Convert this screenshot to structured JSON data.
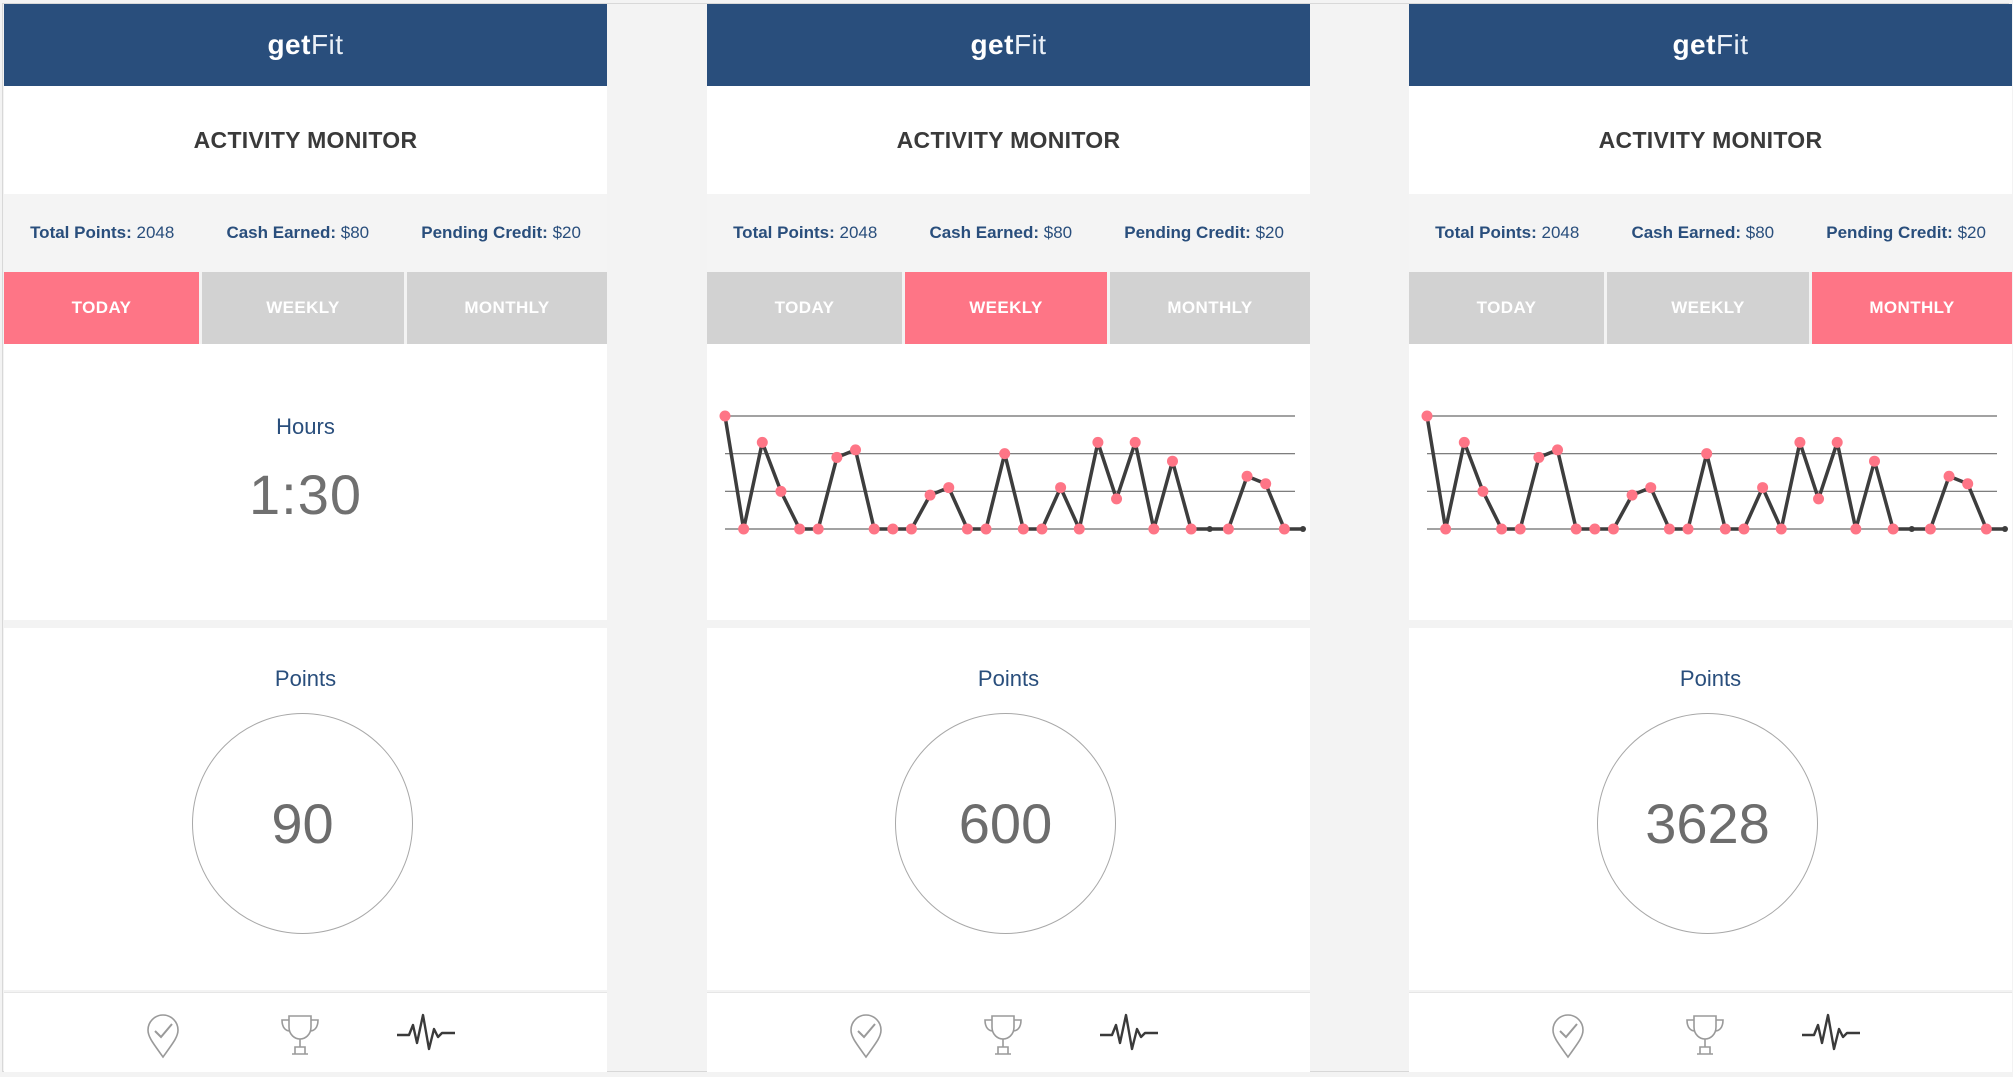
{
  "screens": [
    {
      "brand": {
        "bold": "get",
        "light": "Fit"
      },
      "title": "ACTIVITY MONITOR",
      "stats": [
        {
          "label": "Total Points:",
          "value": "2048"
        },
        {
          "label": "Cash Earned:",
          "value": "$80"
        },
        {
          "label": "Pending Credit:",
          "value": "$20"
        }
      ],
      "tabs": [
        {
          "label": "TODAY",
          "active": true
        },
        {
          "label": "WEEKLY",
          "active": false
        },
        {
          "label": "MONTHLY",
          "active": false
        }
      ],
      "hours": {
        "label": "Hours",
        "value": "1:30"
      },
      "points": {
        "label": "Points",
        "value": "90"
      },
      "nav": {
        "icons": [
          "check-pin-icon",
          "trophy-icon",
          "activity-pulse-icon"
        ]
      }
    },
    {
      "brand": {
        "bold": "get",
        "light": "Fit"
      },
      "title": "ACTIVITY MONITOR",
      "stats": [
        {
          "label": "Total Points:",
          "value": "2048"
        },
        {
          "label": "Cash Earned:",
          "value": "$80"
        },
        {
          "label": "Pending Credit:",
          "value": "$20"
        }
      ],
      "tabs": [
        {
          "label": "TODAY",
          "active": false
        },
        {
          "label": "WEEKLY",
          "active": true
        },
        {
          "label": "MONTHLY",
          "active": false
        }
      ],
      "points": {
        "label": "Points",
        "value": "600"
      },
      "nav": {
        "icons": [
          "check-pin-icon",
          "trophy-icon",
          "activity-pulse-icon"
        ]
      }
    },
    {
      "brand": {
        "bold": "get",
        "light": "Fit"
      },
      "title": "ACTIVITY MONITOR",
      "stats": [
        {
          "label": "Total Points:",
          "value": "2048"
        },
        {
          "label": "Cash Earned:",
          "value": "$80"
        },
        {
          "label": "Pending Credit:",
          "value": "$20"
        }
      ],
      "tabs": [
        {
          "label": "TODAY",
          "active": false
        },
        {
          "label": "WEEKLY",
          "active": false
        },
        {
          "label": "MONTHLY",
          "active": true
        }
      ],
      "points": {
        "label": "Points",
        "value": "3628"
      },
      "nav": {
        "icons": [
          "check-pin-icon",
          "trophy-icon",
          "activity-pulse-icon"
        ]
      }
    }
  ],
  "colors": {
    "header": "#294e7c",
    "accent": "#fe7586",
    "tab_inactive": "#d2d2d2",
    "line": "#3d3d3d",
    "gridline": "#6b6b6b"
  },
  "chart_data": [
    {
      "type": "line",
      "panel": "WEEKLY",
      "grid": true,
      "ylim": [
        0,
        3
      ],
      "x": [
        0,
        1,
        2,
        3,
        4,
        5,
        6,
        7,
        8,
        9,
        10,
        11,
        12,
        13,
        14,
        15,
        16,
        17,
        18,
        19,
        20,
        21,
        22,
        23,
        24,
        25,
        26,
        27,
        28,
        29,
        30,
        31
      ],
      "values": [
        3,
        0,
        2.3,
        1,
        0,
        0,
        1.9,
        2.1,
        0,
        0,
        0,
        0.9,
        1.1,
        0,
        0,
        2,
        0,
        0,
        1.1,
        0,
        2.3,
        0.8,
        2.3,
        0,
        1.8,
        0,
        0,
        0,
        1.4,
        1.2,
        0,
        0
      ],
      "markers": [
        true,
        true,
        true,
        true,
        true,
        true,
        true,
        true,
        true,
        true,
        true,
        true,
        true,
        true,
        true,
        true,
        true,
        true,
        true,
        true,
        true,
        true,
        true,
        true,
        true,
        true,
        false,
        true,
        true,
        true,
        true,
        false
      ]
    },
    {
      "type": "line",
      "panel": "MONTHLY",
      "grid": true,
      "ylim": [
        0,
        3
      ],
      "x": [
        0,
        1,
        2,
        3,
        4,
        5,
        6,
        7,
        8,
        9,
        10,
        11,
        12,
        13,
        14,
        15,
        16,
        17,
        18,
        19,
        20,
        21,
        22,
        23,
        24,
        25,
        26,
        27,
        28,
        29,
        30,
        31
      ],
      "values": [
        3,
        0,
        2.3,
        1,
        0,
        0,
        1.9,
        2.1,
        0,
        0,
        0,
        0.9,
        1.1,
        0,
        0,
        2,
        0,
        0,
        1.1,
        0,
        2.3,
        0.8,
        2.3,
        0,
        1.8,
        0,
        0,
        0,
        1.4,
        1.2,
        0,
        0
      ],
      "markers": [
        true,
        true,
        true,
        true,
        true,
        true,
        true,
        true,
        true,
        true,
        true,
        true,
        true,
        true,
        true,
        true,
        true,
        true,
        true,
        true,
        true,
        true,
        true,
        true,
        true,
        true,
        false,
        true,
        true,
        true,
        true,
        false
      ]
    }
  ]
}
